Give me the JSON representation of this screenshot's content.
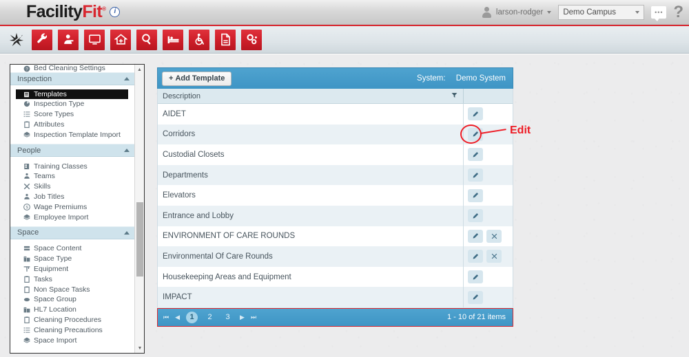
{
  "app": {
    "logo_primary": "Facility",
    "logo_secondary": "Fit",
    "logo_tm": "®",
    "info_badge": "i"
  },
  "header": {
    "username": "larson-rodger",
    "campus_selected": "Demo Campus",
    "help_label": "?",
    "chat_label": "•••",
    "icons": {
      "avatar": "user-avatar-icon",
      "caret": "chevron-down-icon",
      "chat": "chat-bubble-icon",
      "help": "help-question-icon"
    }
  },
  "toolbar": {
    "items": [
      {
        "name": "sparkle-icon",
        "red": false
      },
      {
        "name": "wrench-icon",
        "red": true
      },
      {
        "name": "person-icon",
        "red": true
      },
      {
        "name": "monitor-icon",
        "red": true
      },
      {
        "name": "home-plus-icon",
        "red": true
      },
      {
        "name": "magnifier-icon",
        "red": true
      },
      {
        "name": "bed-icon",
        "red": true
      },
      {
        "name": "wheelchair-icon",
        "red": true
      },
      {
        "name": "document-icon",
        "red": true
      },
      {
        "name": "gears-icon",
        "red": true
      }
    ]
  },
  "sidebar": {
    "top_partial_item": {
      "label": "Bed Cleaning Settings",
      "icon": "question-circle-icon"
    },
    "sections": [
      {
        "title": "Inspection",
        "items": [
          {
            "label": "Templates",
            "icon": "template-icon",
            "active": true
          },
          {
            "label": "Inspection Type",
            "icon": "pie-icon",
            "active": false
          },
          {
            "label": "Score Types",
            "icon": "list-icon",
            "active": false
          },
          {
            "label": "Attributes",
            "icon": "clipboard-icon",
            "active": false
          },
          {
            "label": "Inspection Template Import",
            "icon": "layers-icon",
            "active": false
          }
        ]
      },
      {
        "title": "People",
        "items": [
          {
            "label": "Training Classes",
            "icon": "book-icon",
            "active": false
          },
          {
            "label": "Teams",
            "icon": "group-icon",
            "active": false
          },
          {
            "label": "Skills",
            "icon": "tools-icon",
            "active": false
          },
          {
            "label": "Job Titles",
            "icon": "group-icon",
            "active": false
          },
          {
            "label": "Wage Premiums",
            "icon": "dollar-icon",
            "active": false
          },
          {
            "label": "Employee Import",
            "icon": "layers-icon",
            "active": false
          }
        ]
      },
      {
        "title": "Space",
        "items": [
          {
            "label": "Space Content",
            "icon": "server-icon",
            "active": false
          },
          {
            "label": "Space Type",
            "icon": "building-icon",
            "active": false
          },
          {
            "label": "Equipment",
            "icon": "equipment-icon",
            "active": false
          },
          {
            "label": "Tasks",
            "icon": "clipboard-icon",
            "active": false
          },
          {
            "label": "Non Space Tasks",
            "icon": "clipboard-icon",
            "active": false
          },
          {
            "label": "Space Group",
            "icon": "group-shape-icon",
            "active": false
          },
          {
            "label": "HL7 Location",
            "icon": "building-icon",
            "active": false
          },
          {
            "label": "Cleaning Procedures",
            "icon": "clipboard-icon",
            "active": false
          },
          {
            "label": "Cleaning Precautions",
            "icon": "list-icon",
            "active": false
          },
          {
            "label": "Space Import",
            "icon": "layers-icon",
            "active": false
          }
        ]
      }
    ],
    "scroll_up_icon": "scroll-up-arrow",
    "scroll_down_icon": "scroll-down-arrow"
  },
  "panel": {
    "add_button": "Add Template",
    "add_button_prefix": "+",
    "system_key": "System:",
    "system_value": "Demo System",
    "column_description": "Description",
    "filter_icon": "funnel-filter-icon",
    "edit_icon": "pencil-edit-icon",
    "delete_icon": "close-x-icon",
    "rows": [
      {
        "description": "AIDET",
        "can_delete": false
      },
      {
        "description": "Corridors",
        "can_delete": false
      },
      {
        "description": "Custodial Closets",
        "can_delete": false
      },
      {
        "description": "Departments",
        "can_delete": false
      },
      {
        "description": "Elevators",
        "can_delete": false
      },
      {
        "description": "Entrance and Lobby",
        "can_delete": false
      },
      {
        "description": "ENVIRONMENT OF CARE ROUNDS",
        "can_delete": true
      },
      {
        "description": "Environmental Of Care Rounds",
        "can_delete": true
      },
      {
        "description": "Housekeeping Areas and Equipment",
        "can_delete": false
      },
      {
        "description": "IMPACT",
        "can_delete": false
      }
    ]
  },
  "pagination": {
    "first": "⏮",
    "prev": "◀",
    "pages": [
      "1",
      "2",
      "3"
    ],
    "active_page": "1",
    "next": "▶",
    "last": "⏭",
    "info": "1 - 10 of 21 items"
  },
  "annotation": {
    "label": "Edit",
    "color": "#ee1c25"
  },
  "colors": {
    "brand_red": "#d8262f",
    "panel_blue": "#3e95c5",
    "row_alt": "#eaf1f5",
    "sidebar_header": "#cfe3ec"
  }
}
